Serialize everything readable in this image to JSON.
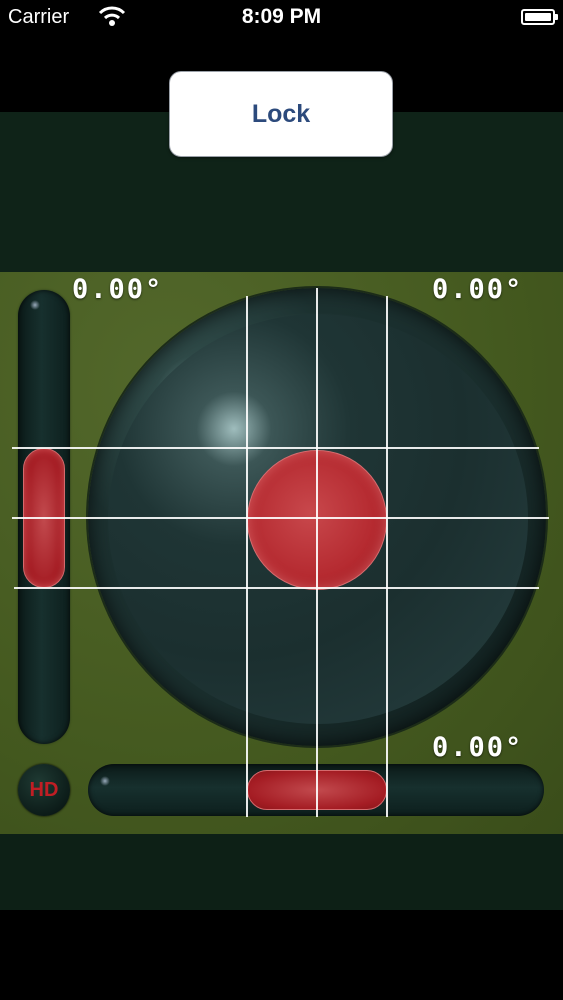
{
  "status_bar": {
    "carrier": "Carrier",
    "time": "8:09 PM",
    "wifi_icon": "wifi-icon",
    "battery_icon": "battery-icon"
  },
  "toolbar": {
    "lock_label": "Lock"
  },
  "readouts": {
    "vertical_angle": "0.00°",
    "circular_angle": "0.00°",
    "horizontal_angle": "0.00°"
  },
  "hd_button": {
    "label": "HD"
  },
  "levels": {
    "vertical_bubble_offset": 0,
    "horizontal_bubble_offset": 0,
    "circular_bubble_offset_x": 0,
    "circular_bubble_offset_y": 0
  },
  "colors": {
    "panel_green": "#44591f",
    "bubble_red": "#b52a30",
    "lock_text": "#2c4a7c",
    "hd_text": "#c01e24"
  }
}
